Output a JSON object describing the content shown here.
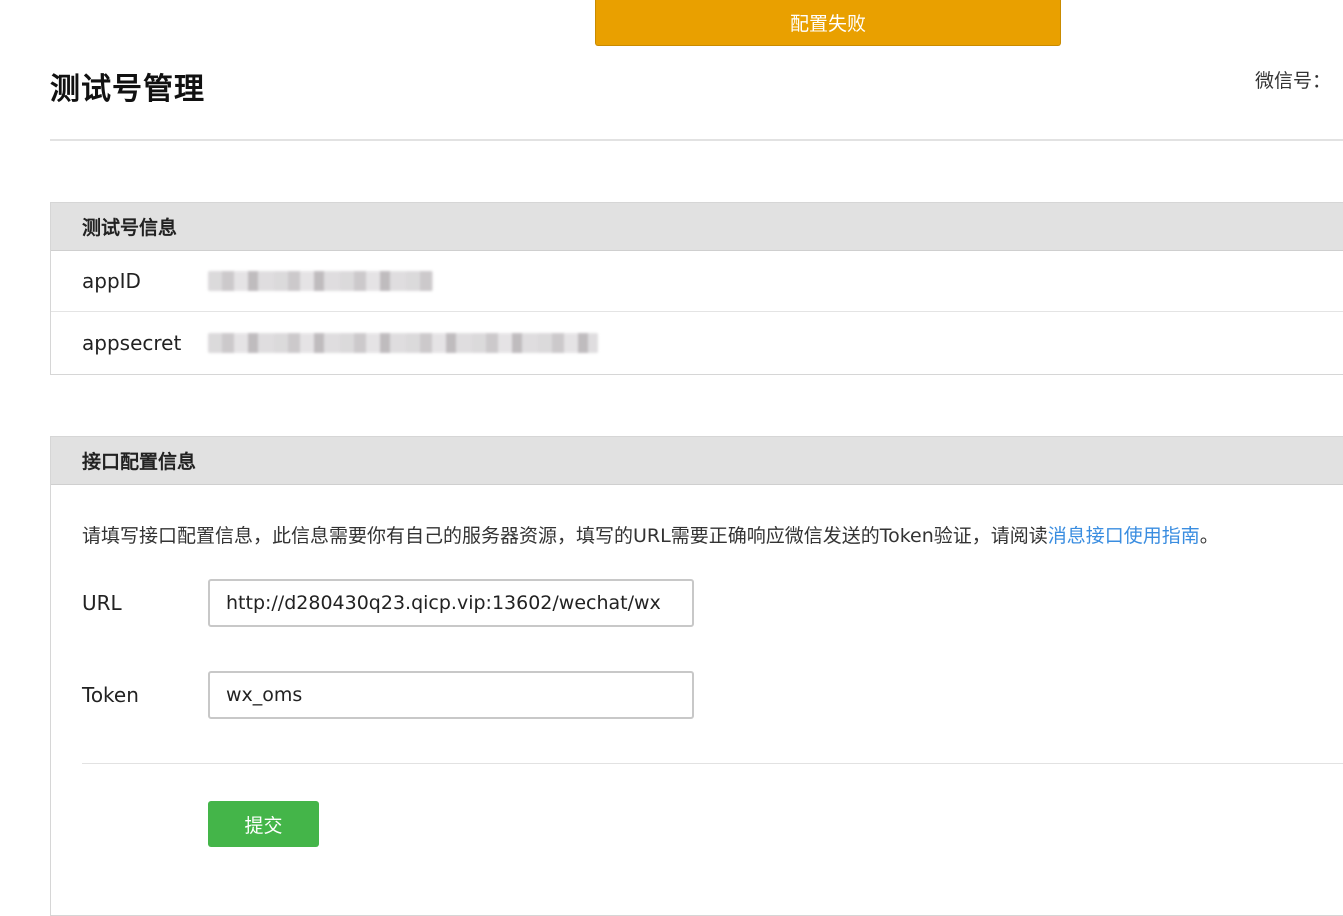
{
  "toast": {
    "message": "配置失败",
    "color": "#e9a000"
  },
  "header": {
    "title": "测试号管理",
    "wechat_id_label": "微信号："
  },
  "test_account_panel": {
    "title": "测试号信息",
    "rows": [
      {
        "label": "appID"
      },
      {
        "label": "appsecret"
      }
    ]
  },
  "api_config_panel": {
    "title": "接口配置信息",
    "description": "请填写接口配置信息，此信息需要你有自己的服务器资源，填写的URL需要正确响应微信发送的Token验证，请阅读",
    "guide_link": "消息接口使用指南",
    "description_end": "。",
    "url_label": "URL",
    "url_value": "http://d280430q23.qicp.vip:13602/wechat/wx",
    "token_label": "Token",
    "token_value": "wx_oms",
    "submit_label": "提交",
    "submit_color": "#44b549",
    "link_color": "#3a8de0"
  }
}
